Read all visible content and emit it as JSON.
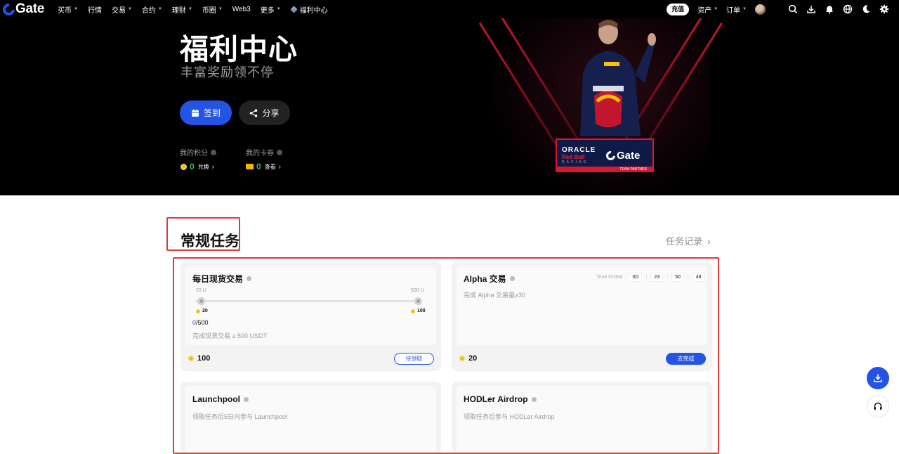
{
  "nav": {
    "brand": "Gate",
    "items": [
      "买币",
      "行情",
      "交易",
      "合约",
      "理财",
      "币圈",
      "Web3",
      "更多",
      "福利中心"
    ],
    "recharge": "充值",
    "assets": "资产",
    "orders": "订单",
    "icons": [
      "search-icon",
      "download-icon",
      "bell-icon",
      "globe-icon",
      "moon-icon",
      "settings-icon"
    ]
  },
  "hero": {
    "title": "福利中心",
    "subtitle": "丰富奖励领不停",
    "signin": "签到",
    "share": "分享",
    "points_label": "我的积分",
    "points_value": "0",
    "points_action": "兑换",
    "coupons_label": "我的卡券",
    "coupons_value": "0",
    "coupons_action": "查看",
    "partner": {
      "oracle": "ORACLE",
      "redbull": "Red Bull",
      "racing": "RACING",
      "gate": "Gate",
      "team_partner": "TEAM PARTNER"
    }
  },
  "section": {
    "title": "常规任务",
    "record": "任务记录"
  },
  "tasks": [
    {
      "title": "每日现货交易",
      "tick_start": "20 U",
      "tick_end": "500 U",
      "mark_start": "20",
      "mark_end": "100",
      "progress_current": "0",
      "progress_total": "/500",
      "desc": "完成现货交易 ≥ 500 USDT",
      "reward": "100",
      "button": "待领取"
    },
    {
      "title": "Alpha 交易",
      "timer_label": "Time limited",
      "timer": [
        "0D",
        "23",
        "50",
        "48"
      ],
      "desc": "完成 Alpha 交易量≥30",
      "reward": "20",
      "button": "去完成"
    },
    {
      "title": "Launchpool",
      "desc": "领取任务后5日内参与 Launchpool"
    },
    {
      "title": "HODLer Airdrop",
      "desc": "领取任务后参与 HODLer Airdrop"
    }
  ],
  "colors": {
    "accent": "#2354e6",
    "highlight": "#e03a3a",
    "success": "#1fc36a",
    "coin": "#f7b500"
  }
}
